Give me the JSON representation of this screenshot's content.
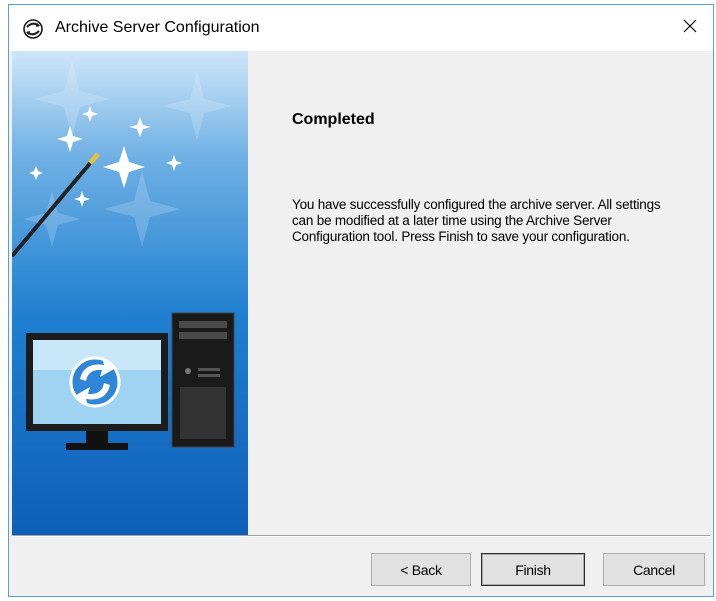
{
  "window": {
    "title": "Archive Server Configuration",
    "close_glyph": "✕"
  },
  "icons": {
    "app": "archive-server-icon",
    "close": "close-icon",
    "banner": [
      "magic-wand-icon",
      "computer-sync-icon"
    ]
  },
  "colors": {
    "banner_top": "#cfe6f8",
    "banner_bottom": "#0f5fb8",
    "border": "#5aa0d8"
  },
  "content": {
    "heading": "Completed",
    "description": "You have successfully configured the archive server. All settings can be modified at a later time using the Archive Server Configuration tool. Press Finish to save your configuration."
  },
  "buttons": {
    "back": "< Back",
    "finish": "Finish",
    "cancel": "Cancel"
  }
}
